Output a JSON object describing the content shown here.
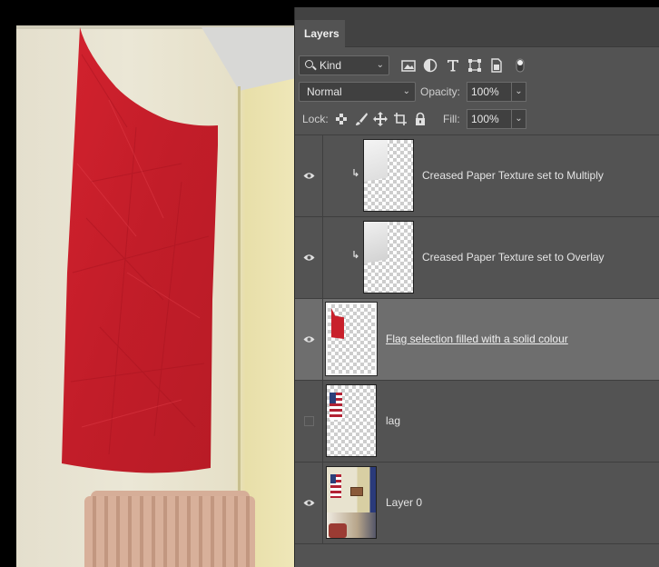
{
  "panel": {
    "tab_label": "Layers",
    "filter": {
      "kind_label": "Kind",
      "icons": [
        "pixel-filter-icon",
        "adjustment-filter-icon",
        "type-filter-icon",
        "shape-filter-icon",
        "smart-object-filter-icon",
        "filter-toggle-icon"
      ]
    },
    "blend_mode": "Normal",
    "opacity_label": "Opacity:",
    "opacity_value": "100%",
    "lock_label": "Lock:",
    "lock_icons": [
      "lock-transparent-pixels-icon",
      "lock-image-pixels-icon",
      "lock-position-icon",
      "prevent-auto-nesting-icon",
      "lock-all-icon"
    ],
    "fill_label": "Fill:",
    "fill_value": "100%"
  },
  "layers": [
    {
      "name": "Creased Paper Texture set to Multiply",
      "visible": true,
      "clipped": true,
      "selected": false,
      "thumb": "paper-texture"
    },
    {
      "name": "Creased Paper Texture set to Overlay",
      "visible": true,
      "clipped": true,
      "selected": false,
      "thumb": "paper-texture"
    },
    {
      "name": "Flag selection filled with a solid colour",
      "visible": true,
      "clipped": false,
      "selected": true,
      "thumb": "red-flag"
    },
    {
      "name": "lag",
      "visible": false,
      "clipped": false,
      "selected": false,
      "thumb": "us-flag"
    },
    {
      "name": "Layer 0",
      "visible": true,
      "clipped": false,
      "selected": false,
      "thumb": "room-photo"
    }
  ],
  "colors": {
    "panel_bg": "#535353",
    "selected_row": "#6e6e6e",
    "flag_red": "#c8202b"
  }
}
